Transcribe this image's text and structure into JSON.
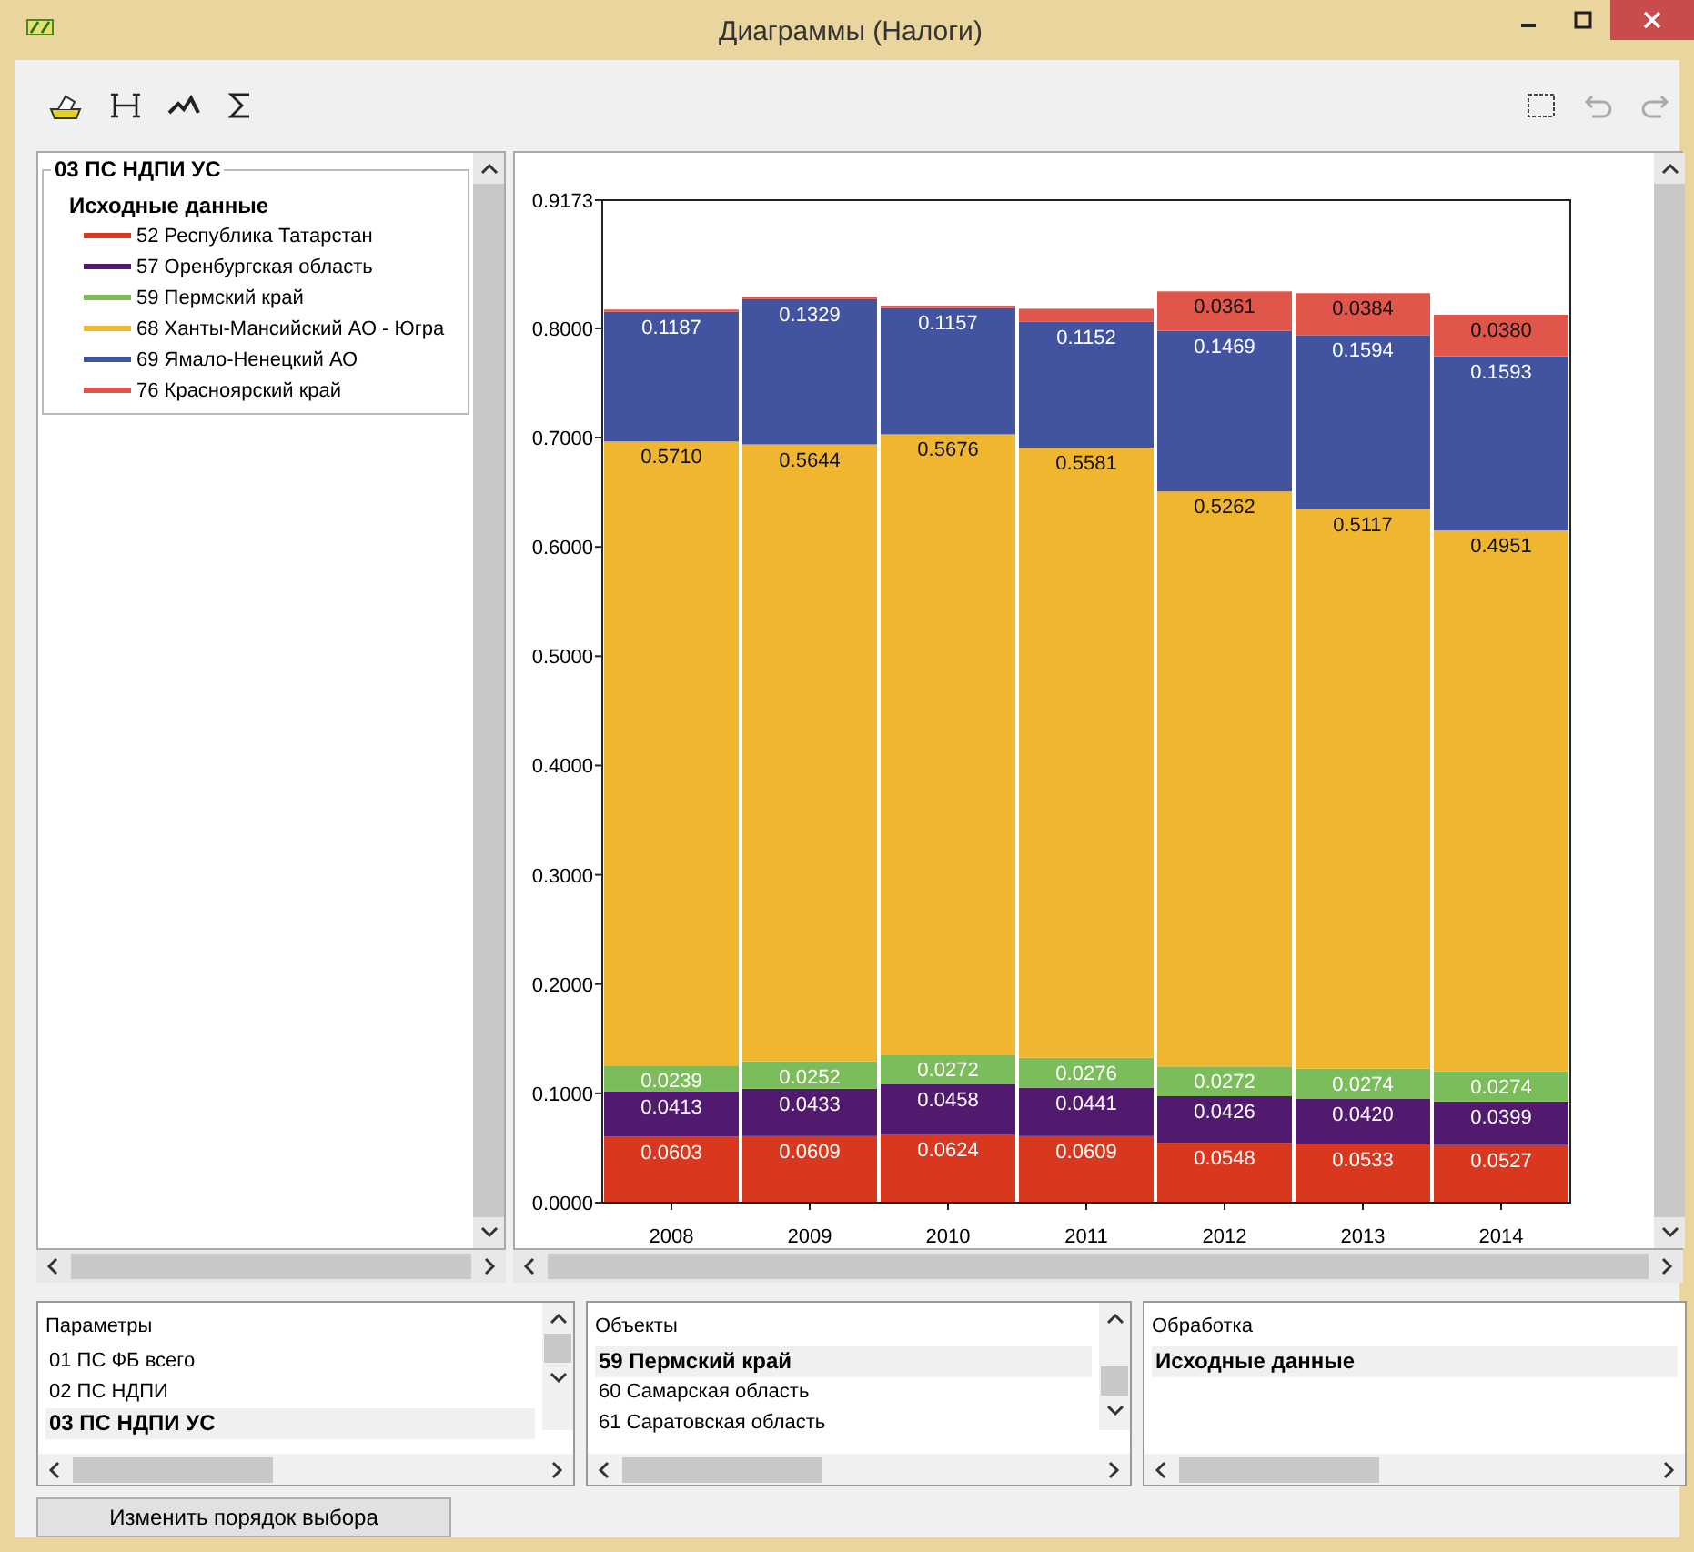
{
  "window": {
    "title": "Диаграммы (Налоги)"
  },
  "legend": {
    "title": "03 ПС НДПИ УС",
    "group": "Исходные данные"
  },
  "chart": {
    "chart_data": {
      "type": "bar",
      "stacked": true,
      "categories": [
        "2008",
        "2009",
        "2010",
        "2011",
        "2012",
        "2013",
        "2014"
      ],
      "ylim": [
        0,
        0.9173
      ],
      "yticks": [
        {
          "value": 0,
          "label": "0.0000"
        },
        {
          "value": 0.1,
          "label": "0.1000"
        },
        {
          "value": 0.2,
          "label": "0.2000"
        },
        {
          "value": 0.3,
          "label": "0.3000"
        },
        {
          "value": 0.4,
          "label": "0.4000"
        },
        {
          "value": 0.5,
          "label": "0.5000"
        },
        {
          "value": 0.6,
          "label": "0.6000"
        },
        {
          "value": 0.7,
          "label": "0.7000"
        },
        {
          "value": 0.8,
          "label": "0.8000"
        },
        {
          "value": 0.9173,
          "label": "0.9173"
        }
      ],
      "series": [
        {
          "name": "52 Республика Татарстан",
          "color": "#d9381e",
          "values": [
            0.0603,
            0.0609,
            0.0624,
            0.0609,
            0.0548,
            0.0533,
            0.0527
          ],
          "value_labels": [
            "0.0603",
            "0.0609",
            "0.0624",
            "0.0609",
            "0.0548",
            "0.0533",
            "0.0527"
          ]
        },
        {
          "name": "57 Оренбургская область",
          "color": "#521a6e",
          "values": [
            0.0413,
            0.0433,
            0.0458,
            0.0441,
            0.0426,
            0.042,
            0.0399
          ],
          "value_labels": [
            "0.0413",
            "0.0433",
            "0.0458",
            "0.0441",
            "0.0426",
            "0.0420",
            "0.0399"
          ]
        },
        {
          "name": "59 Пермский край",
          "color": "#7bbd5a",
          "values": [
            0.0239,
            0.0252,
            0.0272,
            0.0276,
            0.0272,
            0.0274,
            0.0274
          ],
          "value_labels": [
            "0.0239",
            "0.0252",
            "0.0272",
            "0.0276",
            "0.0272",
            "0.0274",
            "0.0274"
          ]
        },
        {
          "name": "68 Ханты-Мансийский АО - Югра",
          "color": "#f0b630",
          "values": [
            0.571,
            0.5644,
            0.5676,
            0.5581,
            0.5262,
            0.5117,
            0.4951
          ],
          "value_labels": [
            "0.5710",
            "0.5644",
            "0.5676",
            "0.5581",
            "0.5262",
            "0.5117",
            "0.4951"
          ]
        },
        {
          "name": "69 Ямало-Ненецкий АО",
          "color": "#4254a0",
          "values": [
            0.1187,
            0.1329,
            0.1157,
            0.1152,
            0.1469,
            0.1594,
            0.1593
          ],
          "value_labels": [
            "0.1187",
            "0.1329",
            "0.1157",
            "0.1152",
            "0.1469",
            "0.1594",
            "0.1593"
          ]
        },
        {
          "name": "76 Красноярский край",
          "color": "#e0564a",
          "values": [
            0.002,
            0.002,
            0.002,
            0.012,
            0.0361,
            0.0384,
            0.038
          ],
          "value_labels": [
            null,
            null,
            null,
            null,
            "0.0361",
            "0.0384",
            "0.0380"
          ]
        }
      ]
    }
  },
  "lists": [
    {
      "title": "Параметры",
      "items": [
        {
          "label": "01 ПС ФБ всего",
          "selected": false
        },
        {
          "label": "02 ПС НДПИ",
          "selected": false
        },
        {
          "label": "03 ПС НДПИ УС",
          "selected": true
        }
      ]
    },
    {
      "title": "Объекты",
      "items": [
        {
          "label": "59 Пермский край",
          "selected": true
        },
        {
          "label": "60 Самарская область",
          "selected": false
        },
        {
          "label": "61 Саратовская область",
          "selected": false
        }
      ]
    },
    {
      "title": "Обработка",
      "items": [
        {
          "label": "Исходные данные",
          "selected": true
        }
      ]
    }
  ],
  "button": "Изменить порядок выбора"
}
